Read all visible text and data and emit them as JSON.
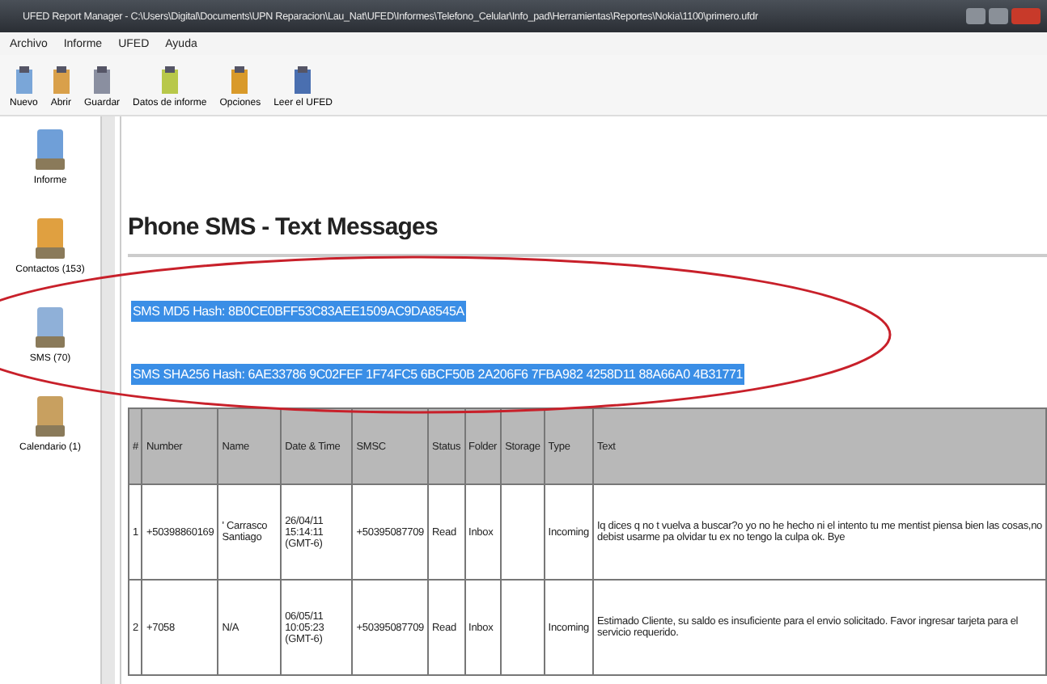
{
  "window": {
    "title": "UFED Report Manager - C:\\Users\\Digital\\Documents\\UPN Reparacion\\Lau_Nat\\UFED\\Informes\\Telefono_Celular\\Info_pad\\Herramientas\\Reportes\\Nokia\\1100\\primero.ufdr"
  },
  "menu": [
    "Archivo",
    "Informe",
    "UFED",
    "Ayuda"
  ],
  "toolbar": [
    {
      "label": "Nuevo",
      "kind": "new"
    },
    {
      "label": "Abrir",
      "kind": "open"
    },
    {
      "label": "Guardar",
      "kind": "save"
    },
    {
      "label": "Datos de informe",
      "kind": "report"
    },
    {
      "label": "Opciones",
      "kind": "options"
    },
    {
      "label": "Leer el UFED",
      "kind": "read"
    }
  ],
  "sidebar": {
    "items": [
      {
        "label": "Informe",
        "kind": "report"
      },
      {
        "label": "Contactos (153)",
        "kind": "contacts"
      },
      {
        "label": "SMS (70)",
        "kind": "sms"
      },
      {
        "label": "Calendario (1)",
        "kind": "calendar"
      }
    ]
  },
  "page": {
    "title": "Phone SMS - Text Messages",
    "hashes": [
      {
        "text": "SMS MD5 Hash: 8B0CE0BFF53C83AEE1509AC9DA8545A",
        "highlighted": true
      },
      {
        "text": "SMS SHA256 Hash: 6AE33786 9C02FEF 1F74FC5 6BCF50B 2A206F6 7FBA982 4258D11 88A66A0 4B31771",
        "highlighted": true
      }
    ]
  },
  "table": {
    "columns": [
      "#",
      "Number",
      "Name",
      "Date & Time",
      "SMSC",
      "Status",
      "Folder",
      "Storage",
      "Type",
      "Text"
    ],
    "rows": [
      [
        "1",
        "+50398860169",
        "' Carrasco Santiago",
        "26/04/11 15:14:11 (GMT-6)",
        "+50395087709",
        "Read",
        "Inbox",
        "",
        "Incoming",
        "Iq dices q no t vuelva a buscar?o yo no he hecho ni el intento tu me mentist piensa bien las cosas,no debist usarme pa olvidar tu ex no tengo la culpa ok. Bye"
      ],
      [
        "2",
        "+7058",
        "N/A",
        "06/05/11 10:05:23 (GMT-6)",
        "+50395087709",
        "Read",
        "Inbox",
        "",
        "Incoming",
        "Estimado Cliente, su saldo es insuficiente para el envio solicitado. Favor ingresar tarjeta para el servicio requerido."
      ]
    ]
  }
}
